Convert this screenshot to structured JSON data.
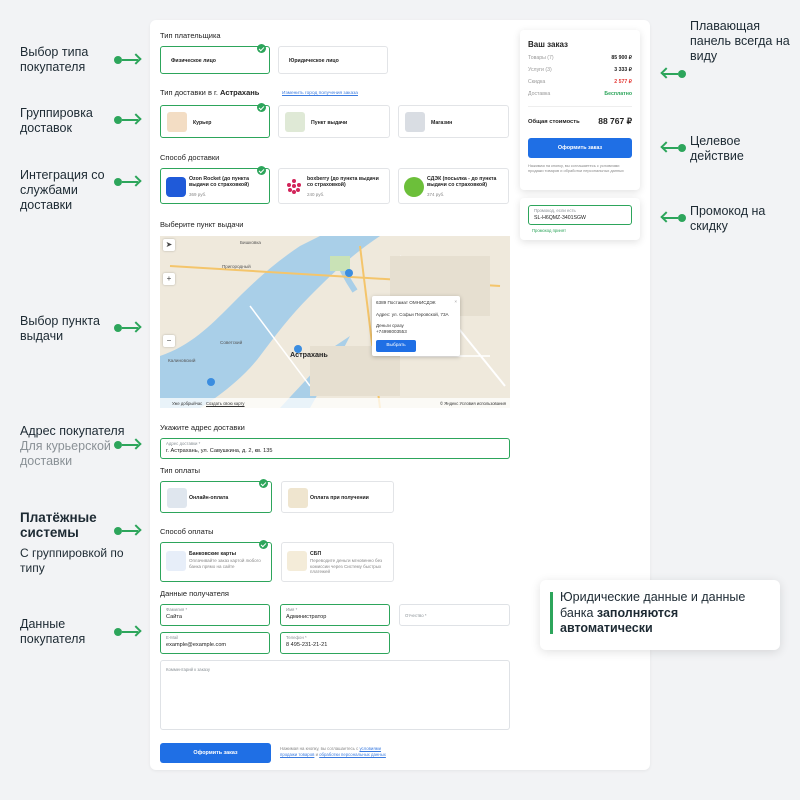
{
  "annotations": {
    "buyer_type": "Выбор типа покупателя",
    "grouping": "Группировка доставок",
    "integration": "Интеграция со службами доставки",
    "pickup": "Выбор пункта выдачи",
    "address": "Адрес покупателя",
    "address_sub": "Для курьерской доставки",
    "payment_title": "Платёжные системы",
    "payment_sub": "С группировкой по типу",
    "buyer_data": "Данные покупателя",
    "floating": "Плавающая панель всегда на виду",
    "target": "Целевое действие",
    "promo": "Промокод на скидку",
    "legal_pre": "Юридические данные и данные банка ",
    "legal_bold": "заполняются автоматически"
  },
  "payer": {
    "title": "Тип плательщика",
    "options": [
      "Физическое лицо",
      "Юридическое лицо"
    ]
  },
  "delivery_type": {
    "title_pre": "Тип доставки в г. ",
    "city": "Астрахань",
    "change_link": "Изменить город получения заказа",
    "options": [
      "Курьер",
      "Пункт выдачи",
      "Магазин"
    ]
  },
  "delivery_method": {
    "title": "Способ доставки",
    "options": [
      {
        "name": "Ozon Rocket (до пункта выдачи со страховкой)",
        "price": "369 руб."
      },
      {
        "name": "boxberry (до пункта выдачи со страховкой)",
        "price": "240 руб."
      },
      {
        "name": "СДЭК (посылка - до пункта выдачи со страховкой)",
        "price": "374 руб."
      }
    ]
  },
  "map": {
    "title": "Выберите пункт выдачи",
    "city_label": "Астрахань",
    "labels": [
      "Бишковка",
      "Пригородный",
      "Советский",
      "Калиновский"
    ],
    "popup_name": "6389 Постамат ОМНИСДЭК",
    "popup_address": "Адрес: ул. Софьи Перовской, 73А",
    "popup_phone_label": "Деньги сразу",
    "popup_phone": "+74998003553",
    "popup_button": "Выбрать",
    "footer_left": "Уже добрыйчас",
    "footer_mid": "Создать свою карту",
    "footer_right": "© Яндекс Условия использования"
  },
  "address": {
    "title": "Укажите адрес доставки",
    "label": "Адрес доставки *",
    "value": "г. Астрахань, ул. Савушкина, д. 2, кв. 135"
  },
  "payment_type": {
    "title": "Тип оплаты",
    "options": [
      "Онлайн-оплата",
      "Оплата при получении"
    ]
  },
  "payment_method": {
    "title": "Способ оплаты",
    "options": [
      {
        "name": "Банковские карты",
        "desc": "Оплачивайте заказ картой любого банка прямо на сайте"
      },
      {
        "name": "СБП",
        "desc": "Переводите деньги мгновенно без комиссии через Систему быстрых платежей"
      }
    ]
  },
  "recipient": {
    "title": "Данные получателя",
    "fields": [
      {
        "label": "Фамилия *",
        "value": "Сайта"
      },
      {
        "label": "Имя *",
        "value": "Администратор"
      },
      {
        "label": "Отчество *",
        "value": ""
      },
      {
        "label": "E-Mail",
        "value": "example@example.com"
      },
      {
        "label": "Телефон *",
        "value": "8 495-231-21-21"
      }
    ],
    "comment_placeholder": "Комментарий к заказу"
  },
  "bottom": {
    "submit": "Оформить заказ",
    "consent_pre": "Нажимая на кнопку, вы соглашаетесь с ",
    "consent_link1": "условиями продажи товаров",
    "consent_and": " и ",
    "consent_link2": "обработки персональных данных"
  },
  "summary": {
    "title": "Ваш заказ",
    "rows": [
      {
        "label": "Товары (7)",
        "value": "85 900 ₽"
      },
      {
        "label": "Услуги (3)",
        "value": "3 333 ₽"
      },
      {
        "label": "Скидка",
        "value": "2 577 ₽"
      },
      {
        "label": "Доставка",
        "value": "Бесплатно"
      }
    ],
    "total_label": "Общая стоимость",
    "total_value": "88 767 ₽",
    "button": "Оформить заказ",
    "consent": "Нажимая на кнопку, вы соглашаетесь с условиями продажи товаров и обработки персональных данных"
  },
  "promo": {
    "label": "Промокод, если есть",
    "value": "SL-H6QMZ-3401SGW",
    "status": "Промокод принят"
  },
  "colors": {
    "accent": "#2da55b",
    "primary": "#1f6fe5",
    "discount": "#e53935"
  }
}
